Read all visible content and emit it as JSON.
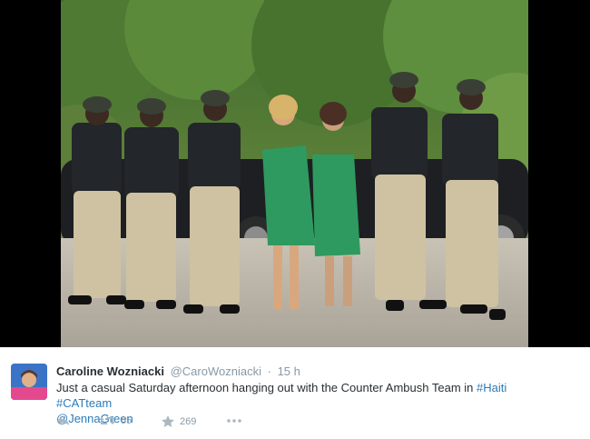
{
  "photo": {
    "description_icon": "photo-media"
  },
  "tweet": {
    "author_name": "Caroline Wozniacki",
    "author_handle": "@CaroWozniacki",
    "separator": "·",
    "time": "15 h",
    "text_main": "Just a casual Saturday afternoon hanging out with the Counter Ambush Team in ",
    "hashtag_1": "#Haiti",
    "hashtag_2": "#CATteam",
    "mention": "@JennaGreen",
    "retweets": "55",
    "favorites": "269"
  },
  "icons": {
    "reply": "reply-icon",
    "retweet": "retweet-icon",
    "favorite": "star-icon",
    "more": "more-icon"
  },
  "colors": {
    "link": "#2b7bb9",
    "meta": "#8899a6",
    "text": "#292f33"
  }
}
